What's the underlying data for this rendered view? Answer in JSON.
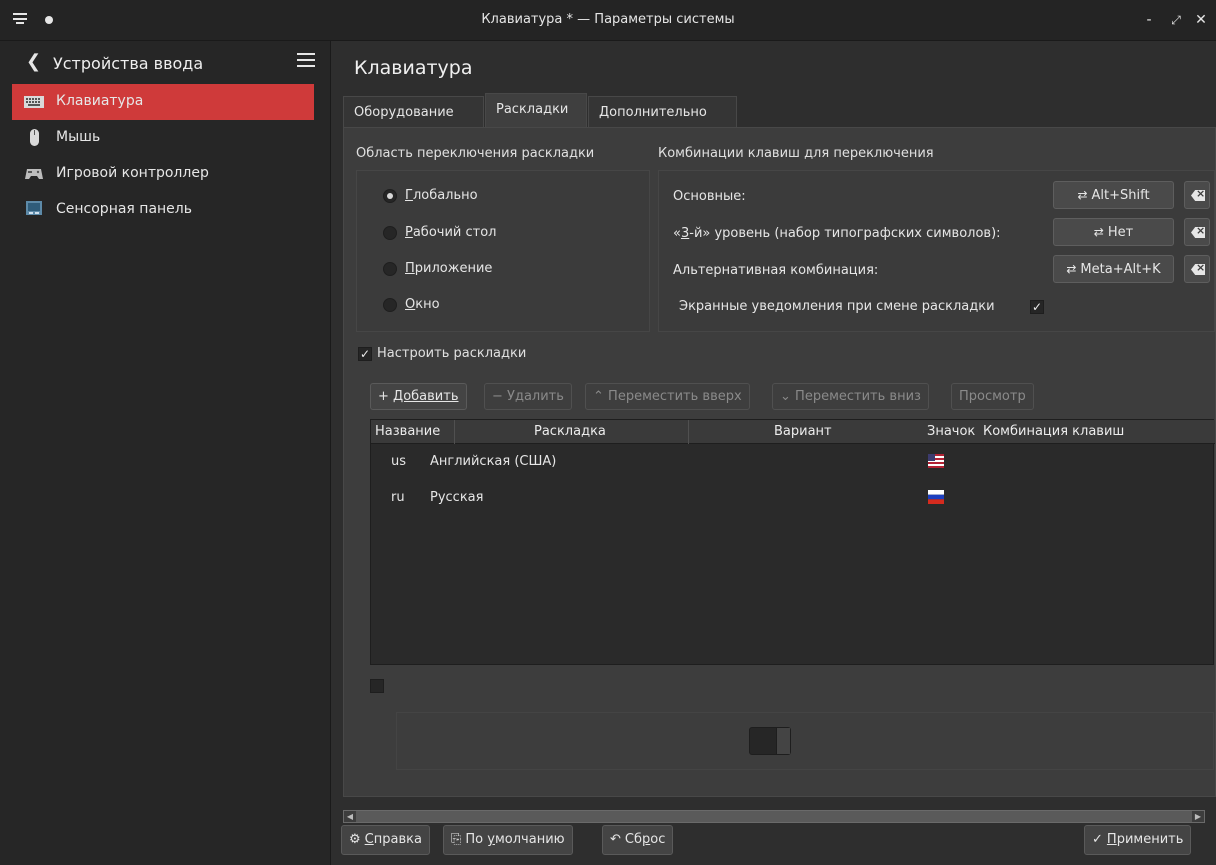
{
  "window": {
    "title": "Клавиатура * — Параметры системы",
    "minimize": "-",
    "maximize": "⤢",
    "close": "✕"
  },
  "sidebar": {
    "title": "Устройства ввода",
    "back": "❮",
    "items": [
      {
        "label": "Клавиатура",
        "icon": "keyboard-icon",
        "active": true
      },
      {
        "label": "Мышь",
        "icon": "mouse-icon",
        "active": false
      },
      {
        "label": "Игровой контроллер",
        "icon": "gamepad-icon",
        "active": false
      },
      {
        "label": "Сенсорная панель",
        "icon": "touchpad-icon",
        "active": false
      }
    ]
  },
  "main": {
    "title": "Клавиатура",
    "tabs": [
      {
        "label": "Оборудование",
        "active": false
      },
      {
        "label": "Раскладки",
        "active": true
      },
      {
        "label": "Дополнительно",
        "active": false
      }
    ]
  },
  "switching": {
    "title": "Область переключения раскладки",
    "options": [
      {
        "pre": "",
        "ul": "Г",
        "post": "лобально",
        "checked": true
      },
      {
        "pre": "",
        "ul": "Р",
        "post": "абочий стол",
        "checked": false
      },
      {
        "pre": "",
        "ul": "П",
        "post": "риложение",
        "checked": false
      },
      {
        "pre": "",
        "ul": "О",
        "post": "кно",
        "checked": false
      }
    ]
  },
  "shortcuts": {
    "title": "Комбинации клавиш для переключения",
    "main_label": "Основные:",
    "main_value": "Alt+Shift",
    "third_label_pre": "«",
    "third_label_ul": "3",
    "third_label_post": "-й» уровень (набор типографских символов):",
    "third_value": "Нет",
    "alt_label": "Альтернативная комбинация:",
    "alt_value": "Meta+Alt+K",
    "osd_label": "Экранные уведомления при смене раскладки",
    "osd_checked": "✓",
    "switch_icon": "⇄"
  },
  "configure": {
    "label": "Настроить раскладки",
    "checked": "✓"
  },
  "toolbar": {
    "add": "Добавить",
    "add_icon": "+",
    "remove": "Удалить",
    "remove_icon": "−",
    "move_up": "Переместить вверх",
    "move_up_icon": "⌃",
    "move_down": "Переместить вниз",
    "move_down_icon": "⌄",
    "preview": "Просмотр"
  },
  "table": {
    "columns": [
      "Название",
      "Раскладка",
      "Вариант",
      "Значок",
      "Комбинация клавиш"
    ],
    "rows": [
      {
        "name": "us",
        "layout": "Английская (США)",
        "variant": "",
        "flag": "us-flag-icon",
        "shortcut": ""
      },
      {
        "name": "ru",
        "layout": "Русская",
        "variant": "",
        "flag": "ru-flag-icon",
        "shortcut": ""
      }
    ]
  },
  "bottom": {
    "help": "Справка",
    "help_ul": "С",
    "help_post": "правка",
    "defaults_pre": "По ",
    "defaults_ul": "у",
    "defaults_post": "молчанию",
    "reset_pre": "Сб",
    "reset_ul": "р",
    "reset_post": "ос",
    "apply_ul": "П",
    "apply_post": "рименить",
    "apply_icon": "✓",
    "reset_icon": "↶",
    "defaults_icon": "⎘",
    "help_icon": "⚙"
  },
  "colors": {
    "accent": "#cf3a3a",
    "panel": "#3d3d3d",
    "sidebar": "#262626"
  }
}
